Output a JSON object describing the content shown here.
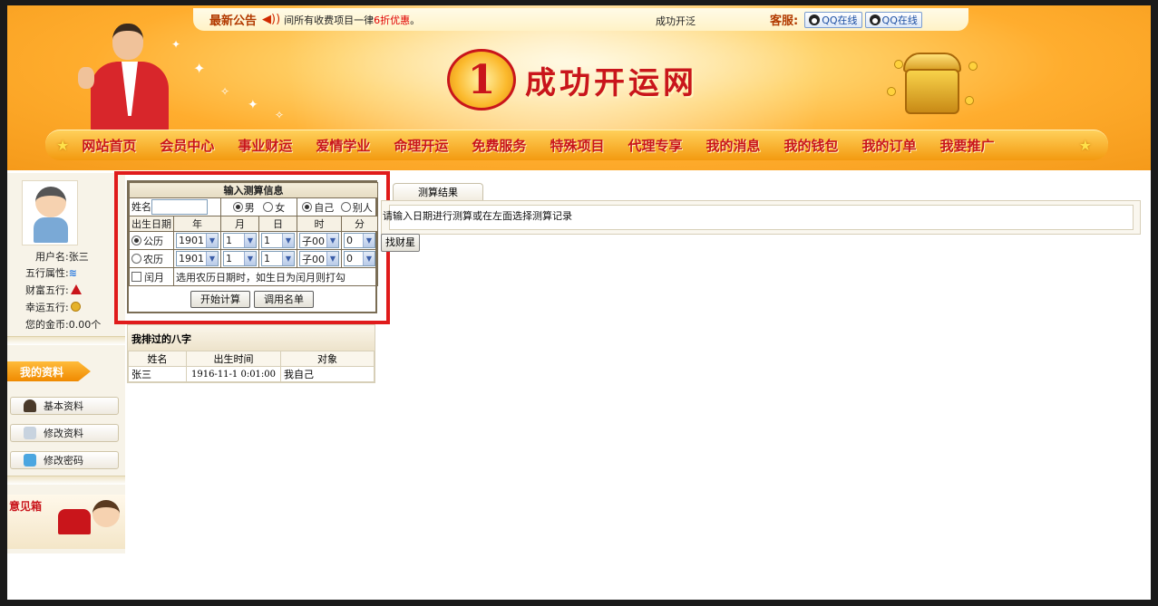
{
  "header": {
    "notice_label": "最新公告",
    "notice_text_prefix": "间所有收费项目一律",
    "notice_text_red": "6折优惠",
    "notice_text_suffix": "。",
    "notice_mid": "成功开泛",
    "service_label": "客服:",
    "qq_buttons": [
      "QQ在线",
      "QQ在线"
    ],
    "logo_digit": "1",
    "site_name": "成功开运网"
  },
  "nav": {
    "items": [
      "网站首页",
      "会员中心",
      "事业财运",
      "爱情学业",
      "命理开运",
      "免费服务",
      "特殊项目",
      "代理专享",
      "我的消息",
      "我的钱包",
      "我的订单",
      "我要推广"
    ]
  },
  "sidebar": {
    "username": "用户名:张三",
    "wuxing_label": "五行属性:",
    "wuxing_icon": "water-icon",
    "wealth_label": "财富五行:",
    "wealth_icon": "fire-icon",
    "lucky_label": "幸运五行:",
    "lucky_icon": "earth-icon",
    "coins": "您的金币:0.00个",
    "section_title": "我的资料",
    "buttons": [
      "基本资料",
      "修改资料",
      "修改密码"
    ],
    "mailbox_label": "意见箱"
  },
  "form": {
    "title": "输入测算信息",
    "name_label": "姓名",
    "name_value": "",
    "gender_male": "男",
    "gender_female": "女",
    "gender_selected": "男",
    "self_label": "自己",
    "other_label": "别人",
    "target_selected": "自己",
    "birth_label": "出生日期",
    "col_year": "年",
    "col_month": "月",
    "col_day": "日",
    "col_hour": "时",
    "col_minute": "分",
    "solar_label": "公历",
    "lunar_label": "农历",
    "calendar_selected": "公历",
    "solar_values": {
      "year": "1901",
      "month": "1",
      "day": "1",
      "hour": "子00",
      "minute": "0"
    },
    "lunar_values": {
      "year": "1901",
      "month": "1",
      "day": "1",
      "hour": "子00",
      "minute": "0"
    },
    "leap_label": "闰月",
    "leap_hint": "选用农历日期时，如生日为闰月则打勾",
    "start_button": "开始计算",
    "call_list_button": "调用名单"
  },
  "history": {
    "title": "我排过的八字",
    "columns": [
      "姓名",
      "出生时间",
      "对象"
    ],
    "rows": [
      {
        "name": "张三",
        "time": "1916-11-1 0:01:00",
        "target": "我自己"
      }
    ]
  },
  "result": {
    "tab_label": "测算结果",
    "message": "请输入日期进行测算或在左面选择测算记录",
    "find_button": "找财星"
  },
  "colors": {
    "brand_red": "#c9151b",
    "highlight_border": "#e01b1b",
    "nav_orange": "#f39a10"
  }
}
